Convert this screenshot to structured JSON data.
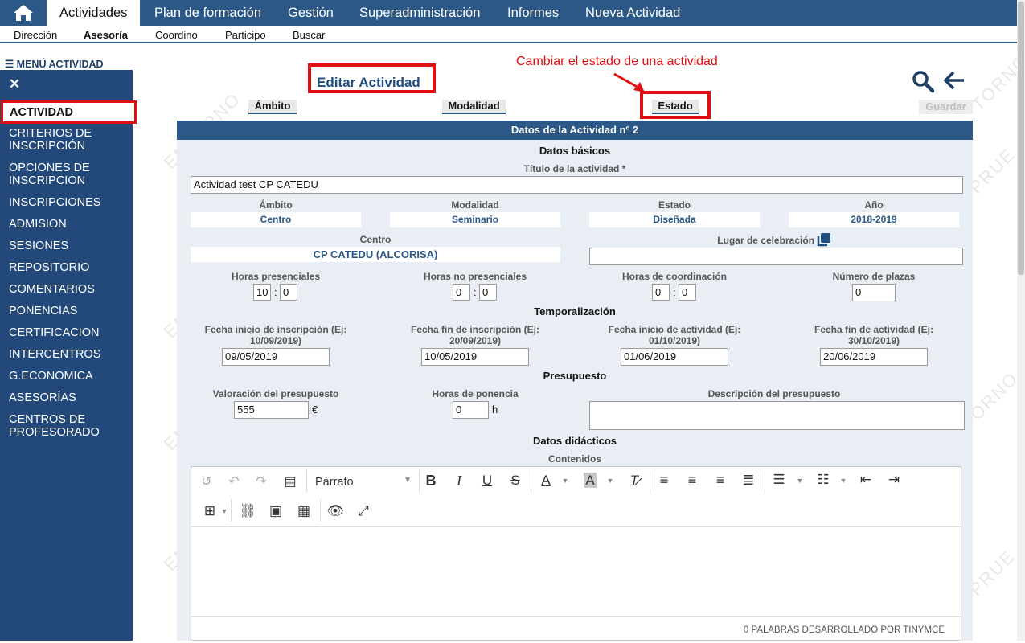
{
  "topnav": {
    "items": [
      "Actividades",
      "Plan de formación",
      "Gestión",
      "Superadministración",
      "Informes",
      "Nueva Actividad"
    ],
    "active": "Actividades"
  },
  "subnav": {
    "items": [
      "Dirección",
      "Asesoría",
      "Coordino",
      "Participo",
      "Buscar"
    ],
    "active": "Asesoría"
  },
  "sidebar": {
    "title": "☰ MENÚ ACTIVIDAD",
    "close": "✕",
    "active": "ACTIVIDAD",
    "items": [
      "CRITERIOS DE INSCRIPCIÓN",
      "OPCIONES DE INSCRIPCIÓN",
      "INSCRIPCIONES",
      "ADMISION",
      "SESIONES",
      "REPOSITORIO",
      "COMENTARIOS",
      "PONENCIAS",
      "CERTIFICACION",
      "INTERCENTROS",
      "G.ECONOMICA",
      "ASESORÍAS",
      "CENTROS DE PROFESORADO"
    ]
  },
  "watermark": "ENTORNO DE PRUEBAS",
  "header": {
    "title": "Editar Actividad",
    "annotation": "Cambiar el estado de una actividad",
    "tabs": [
      "Ámbito",
      "Modalidad",
      "Estado"
    ],
    "save": "Guardar"
  },
  "form": {
    "header": "Datos de la Actividad nº 2",
    "basic_title": "Datos básicos",
    "titulo_label": "Título de la actividad *",
    "titulo_value": "Actividad test CP CATEDU",
    "ambito_label": "Ámbito",
    "ambito_value": "Centro",
    "modalidad_label": "Modalidad",
    "modalidad_value": "Seminario",
    "estado_label": "Estado",
    "estado_value": "Diseñada",
    "anio_label": "Año",
    "anio_value": "2018-2019",
    "centro_label": "Centro",
    "centro_value": "CP CATEDU (ALCORISA)",
    "lugar_label": "Lugar de celebración",
    "lugar_value": "",
    "horas_pres_label": "Horas presenciales",
    "horas_pres_h": "10",
    "horas_pres_m": "0",
    "horas_nopres_label": "Horas no presenciales",
    "horas_nopres_h": "0",
    "horas_nopres_m": "0",
    "horas_coord_label": "Horas de coordinación",
    "horas_coord_h": "0",
    "horas_coord_m": "0",
    "plazas_label": "Número de plazas",
    "plazas_value": "0",
    "temporal_title": "Temporalización",
    "fecha_ini_insc_label": "Fecha inicio de inscripción (Ej: 10/09/2019)",
    "fecha_ini_insc_value": "09/05/2019",
    "fecha_fin_insc_label": "Fecha fin de inscripción (Ej: 20/09/2019)",
    "fecha_fin_insc_value": "10/05/2019",
    "fecha_ini_act_label": "Fecha inicio de actividad (Ej: 01/10/2019)",
    "fecha_ini_act_value": "01/06/2019",
    "fecha_fin_act_label": "Fecha fin de actividad (Ej: 30/10/2019)",
    "fecha_fin_act_value": "20/06/2019",
    "presupuesto_title": "Presupuesto",
    "valoracion_label": "Valoración del presupuesto",
    "valoracion_value": "555",
    "valoracion_unit": "€",
    "horas_ponencia_label": "Horas de ponencia",
    "horas_ponencia_value": "0",
    "horas_ponencia_unit": "h",
    "descripcion_label": "Descripción del presupuesto",
    "descripcion_value": "",
    "didacticos_title": "Datos didácticos",
    "contenidos_label": "Contenidos"
  },
  "editor": {
    "format_select": "Párrafo",
    "status": "0 PALABRAS DESARROLLADO POR TINYMCE"
  },
  "colors": {
    "nav_blue": "#2b5887",
    "sidebar_blue": "#22497a",
    "highlight_red": "#e01010",
    "form_bg": "#e9eef4"
  }
}
